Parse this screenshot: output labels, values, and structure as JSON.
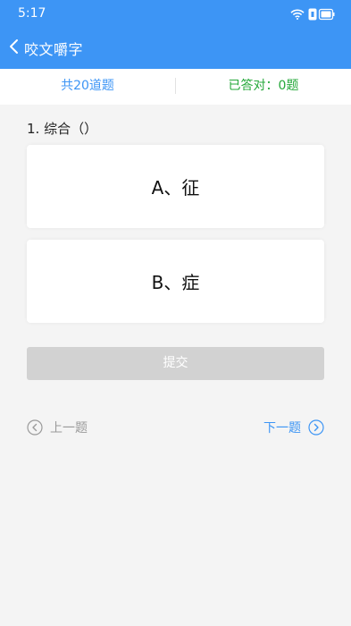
{
  "status_bar": {
    "time": "5:17",
    "icons": [
      "wifi-icon",
      "battery-icon"
    ]
  },
  "header": {
    "back_icon": "chevron-left-icon",
    "title": "咬文嚼字",
    "background_color": "#3d95f5"
  },
  "summary": {
    "total_label": "共20道题",
    "answered_label": "已答对：0题",
    "total_color": "#3d95f5",
    "answered_color": "#25a83a"
  },
  "question": {
    "text": "1. 综合（）"
  },
  "options": [
    {
      "label": "A、征"
    },
    {
      "label": "B、症"
    }
  ],
  "submit": {
    "label": "提交"
  },
  "pagination": {
    "prev_label": "上一题",
    "next_label": "下一题",
    "prev_icon": "chevron-left-circle-icon",
    "next_icon": "chevron-right-circle-icon"
  }
}
